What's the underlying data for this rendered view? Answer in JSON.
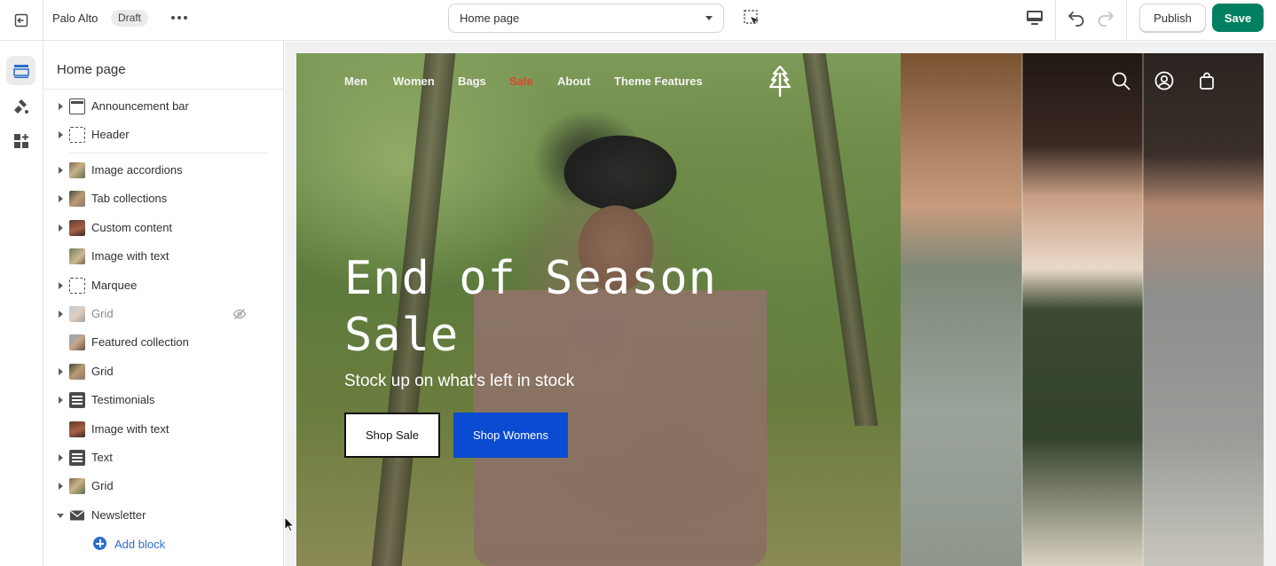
{
  "topbar": {
    "exit_icon": "exit-icon",
    "store_name": "Palo Alto",
    "status_badge": "Draft",
    "more_icon": "ellipsis-icon",
    "page_selector": {
      "selected": "Home page"
    },
    "inspect_icon": "select-element-icon",
    "device_icon": "desktop-icon",
    "undo_icon": "undo-icon",
    "redo_icon": "redo-icon",
    "publish_label": "Publish",
    "save_label": "Save"
  },
  "rail": {
    "items": [
      {
        "icon": "sections-icon",
        "active": true
      },
      {
        "icon": "theme-settings-icon",
        "active": false
      },
      {
        "icon": "apps-icon",
        "active": false
      }
    ]
  },
  "sidebar": {
    "title": "Home page",
    "header_group": [
      {
        "label": "Announcement bar",
        "expandable": true,
        "icon": "announcement-bar-icon"
      },
      {
        "label": "Header",
        "expandable": true,
        "icon": "header-icon"
      }
    ],
    "sections": [
      {
        "label": "Image accordions",
        "expandable": true,
        "icon": "photo-thumb",
        "hidden": false
      },
      {
        "label": "Tab collections",
        "expandable": true,
        "icon": "photo-thumb",
        "hidden": false
      },
      {
        "label": "Custom content",
        "expandable": true,
        "icon": "photo-thumb",
        "hidden": false
      },
      {
        "label": "Image with text",
        "expandable": false,
        "icon": "photo-thumb",
        "hidden": false
      },
      {
        "label": "Marquee",
        "expandable": true,
        "icon": "marquee-icon",
        "hidden": false
      },
      {
        "label": "Grid",
        "expandable": true,
        "icon": "photo-thumb",
        "hidden": true
      },
      {
        "label": "Featured collection",
        "expandable": false,
        "icon": "photo-thumb",
        "hidden": false
      },
      {
        "label": "Grid",
        "expandable": true,
        "icon": "photo-thumb",
        "hidden": false
      },
      {
        "label": "Testimonials",
        "expandable": true,
        "icon": "text-section-icon",
        "hidden": false
      },
      {
        "label": "Image with text",
        "expandable": false,
        "icon": "photo-thumb",
        "hidden": false
      },
      {
        "label": "Text",
        "expandable": true,
        "icon": "text-section-icon",
        "hidden": false
      },
      {
        "label": "Grid",
        "expandable": true,
        "icon": "photo-thumb",
        "hidden": false
      },
      {
        "label": "Newsletter",
        "expandable": true,
        "expanded": true,
        "icon": "envelope-icon",
        "hidden": false
      }
    ],
    "add_block_label": "Add block"
  },
  "preview": {
    "nav": [
      {
        "label": "Men"
      },
      {
        "label": "Women"
      },
      {
        "label": "Bags"
      },
      {
        "label": "Sale",
        "highlight": true
      },
      {
        "label": "About"
      },
      {
        "label": "Theme Features"
      }
    ],
    "logo_icon": "tree-logo-icon",
    "nav_icons": [
      "search-icon",
      "account-icon",
      "cart-icon"
    ],
    "hero": {
      "title": "End of Season Sale",
      "subtitle": "Stock up on what's left in stock",
      "primary_button": "Shop Sale",
      "secondary_button": "Shop Womens"
    },
    "colors": {
      "sale_link": "#e0452e",
      "secondary_button_bg": "#0a4bd1",
      "save_button_bg": "#008060"
    }
  }
}
